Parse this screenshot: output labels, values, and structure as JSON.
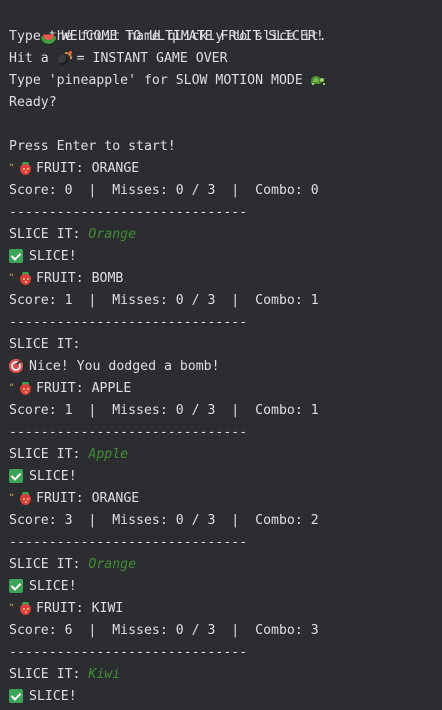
{
  "console": {
    "lines": {
      "l1": {
        "icon": "watermelon-icon",
        "text": "WELCOME TO ULTIMATE FRUIT SLICER!"
      },
      "l2": {
        "text": "Type the fruit name quickly to slice it."
      },
      "l3": {
        "before": "Hit a",
        "icon": "bomb-icon",
        "after": "= INSTANT GAME OVER"
      },
      "l4": {
        "text": "Type 'pineapple' for SLOW MOTION MODE",
        "icon": "turtle-icon"
      },
      "l5": {
        "text": "Ready?"
      },
      "l6": {
        "text": "Press Enter to start!"
      },
      "l7": {
        "icon": "strawberry-icon",
        "text": "FRUIT: ORANGE"
      },
      "l8": {
        "text": "Score: 0  |  Misses: 0 / 3  |  Combo: 0"
      },
      "l9": {
        "text": "------------------------------"
      },
      "l10": {
        "label": "SLICE IT:",
        "input": "Orange"
      },
      "l11": {
        "icon": "check-icon",
        "text": "SLICE!"
      },
      "l12": {
        "icon": "strawberry-icon",
        "text": "FRUIT: BOMB"
      },
      "l13": {
        "text": "Score: 1  |  Misses: 0 / 3  |  Combo: 1"
      },
      "l14": {
        "text": "------------------------------"
      },
      "l15": {
        "label": "SLICE IT:",
        "input": ""
      },
      "l16": {
        "icon": "target-icon",
        "text": "Nice! You dodged a bomb!"
      },
      "l17": {
        "icon": "strawberry-icon",
        "text": "FRUIT: APPLE"
      },
      "l18": {
        "text": "Score: 1  |  Misses: 0 / 3  |  Combo: 1"
      },
      "l19": {
        "text": "------------------------------"
      },
      "l20": {
        "label": "SLICE IT:",
        "input": "Apple"
      },
      "l21": {
        "icon": "check-icon",
        "text": "SLICE!"
      },
      "l22": {
        "icon": "strawberry-icon",
        "text": "FRUIT: ORANGE"
      },
      "l23": {
        "text": "Score: 3  |  Misses: 0 / 3  |  Combo: 2"
      },
      "l24": {
        "text": "------------------------------"
      },
      "l25": {
        "label": "SLICE IT:",
        "input": "Orange"
      },
      "l26": {
        "icon": "check-icon",
        "text": "SLICE!"
      },
      "l27": {
        "icon": "strawberry-icon",
        "text": "FRUIT: KIWI"
      },
      "l28": {
        "text": "Score: 6  |  Misses: 0 / 3  |  Combo: 3"
      },
      "l29": {
        "text": "------------------------------"
      },
      "l30": {
        "label": "SLICE IT:",
        "input": "Kiwi"
      },
      "l31": {
        "icon": "check-icon",
        "text": "SLICE!"
      }
    }
  },
  "colors": {
    "background": "#2b2d30",
    "text": "#dcdfe4",
    "user_input": "#3f8f30"
  }
}
